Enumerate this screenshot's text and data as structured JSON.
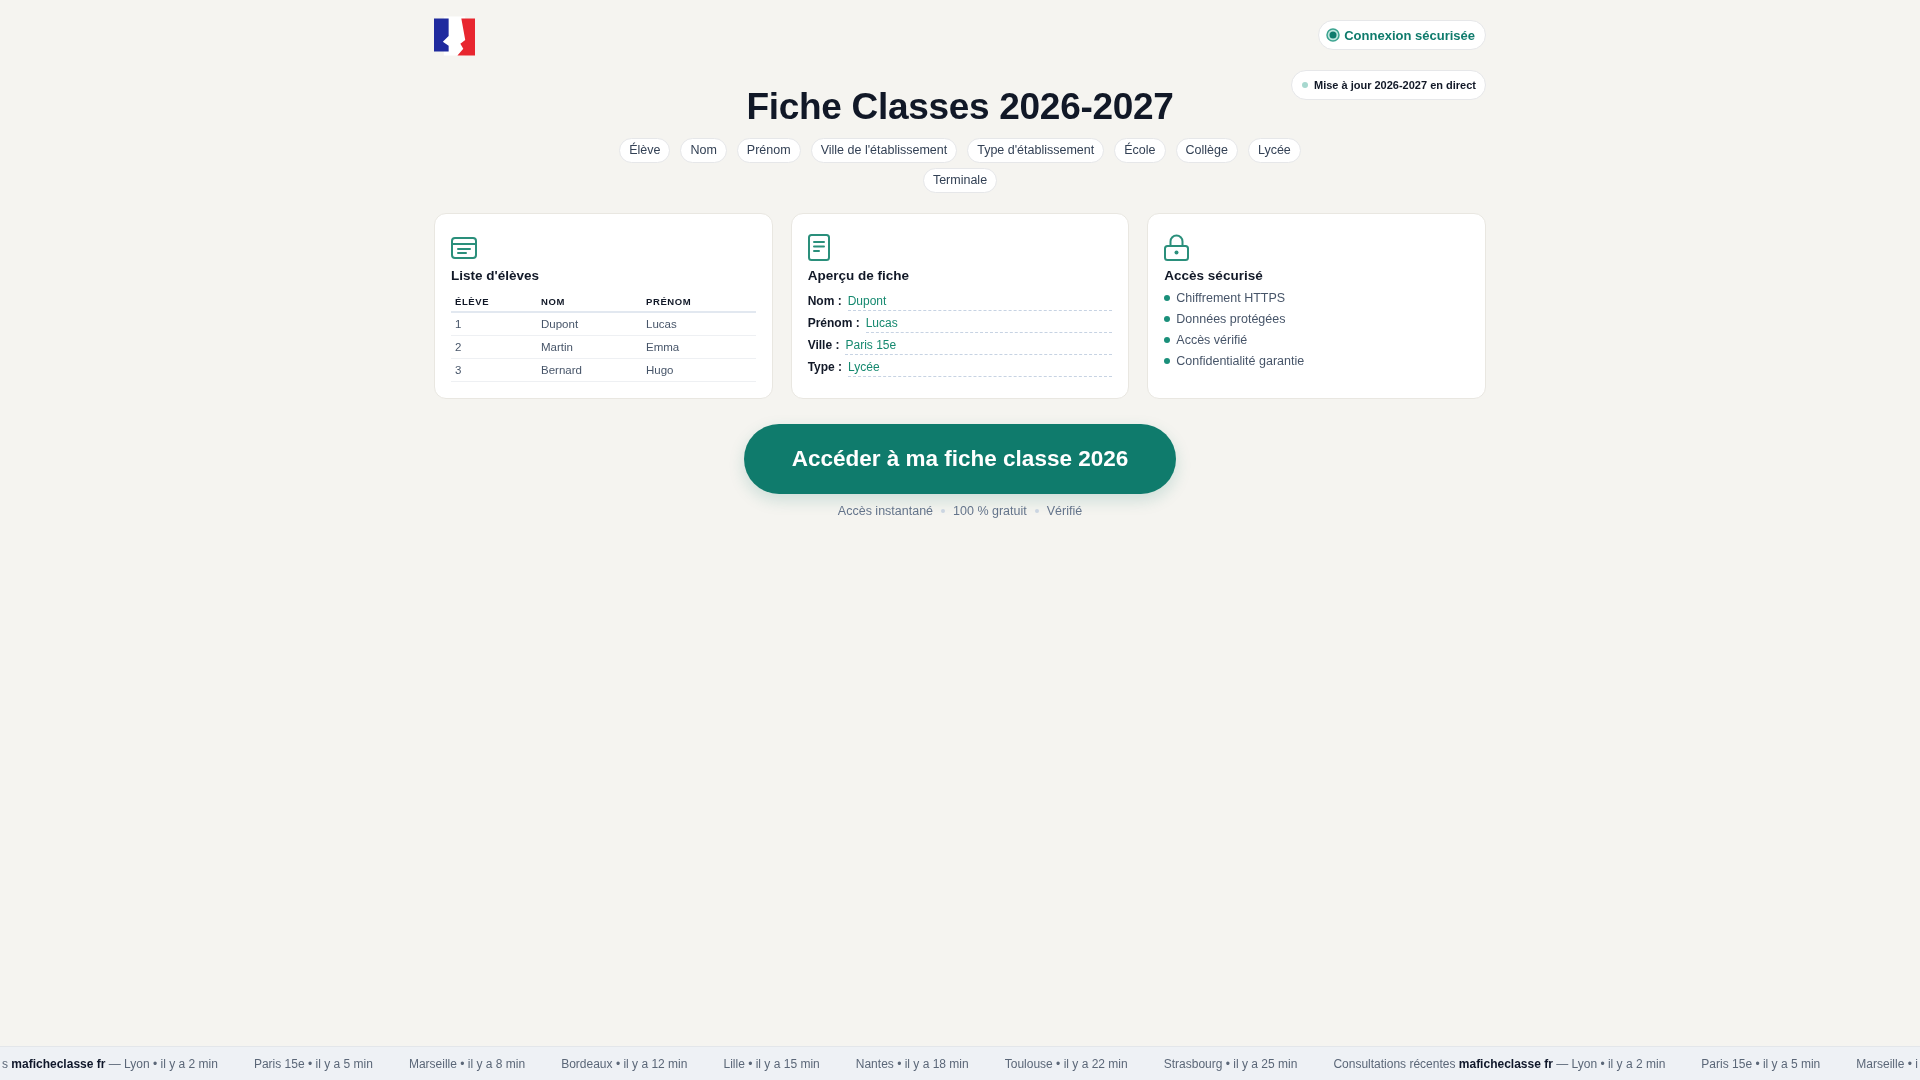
{
  "header": {
    "connection_badge": "Connexion sécurisée",
    "live_badge": "Mise à jour 2026-2027 en direct"
  },
  "title": "Fiche Classes 2026-2027",
  "tags": [
    "Élève",
    "Nom",
    "Prénom",
    "Ville de l'établissement",
    "Type d'établissement",
    "École",
    "Collège",
    "Lycée",
    "Terminale"
  ],
  "cards": [
    {
      "kind": "table",
      "title": "Liste d'élèves",
      "columns": [
        "ÉLÈVE",
        "NOM",
        "PRÉNOM"
      ],
      "rows": [
        [
          "1",
          "Dupont",
          "Lucas"
        ],
        [
          "2",
          "Martin",
          "Emma"
        ],
        [
          "3",
          "Bernard",
          "Hugo"
        ]
      ]
    },
    {
      "kind": "fields",
      "title": "Aperçu de fiche",
      "fields": [
        {
          "label": "Nom :",
          "value": "Dupont"
        },
        {
          "label": "Prénom :",
          "value": "Lucas"
        },
        {
          "label": "Ville :",
          "value": "Paris 15e"
        },
        {
          "label": "Type :",
          "value": "Lycée"
        }
      ]
    },
    {
      "kind": "list",
      "title": "Accès sécurisé",
      "items": [
        "Chiffrement HTTPS",
        "Données protégées",
        "Accès vérifié",
        "Confidentialité garantie"
      ]
    }
  ],
  "cta": {
    "label": "Accéder à ma fiche classe 2026",
    "features": [
      "Accès instantané",
      "100 % gratuit",
      "Vérifié"
    ]
  },
  "ticker": [
    "s **maficheclasse fr** — Lyon • il y a 2 min",
    "Paris 15e • il y a 5 min",
    "Marseille • il y a 8 min",
    "Bordeaux • il y a 12 min",
    "Lille • il y a 15 min",
    "Nantes • il y a 18 min",
    "Toulouse • il y a 22 min",
    "Strasbourg • il y a 25 min",
    "Consultations récentes **maficheclasse fr** — Lyon • il y a 2 min",
    "Paris 15e • il y a 5 min",
    "Marseille • i"
  ]
}
